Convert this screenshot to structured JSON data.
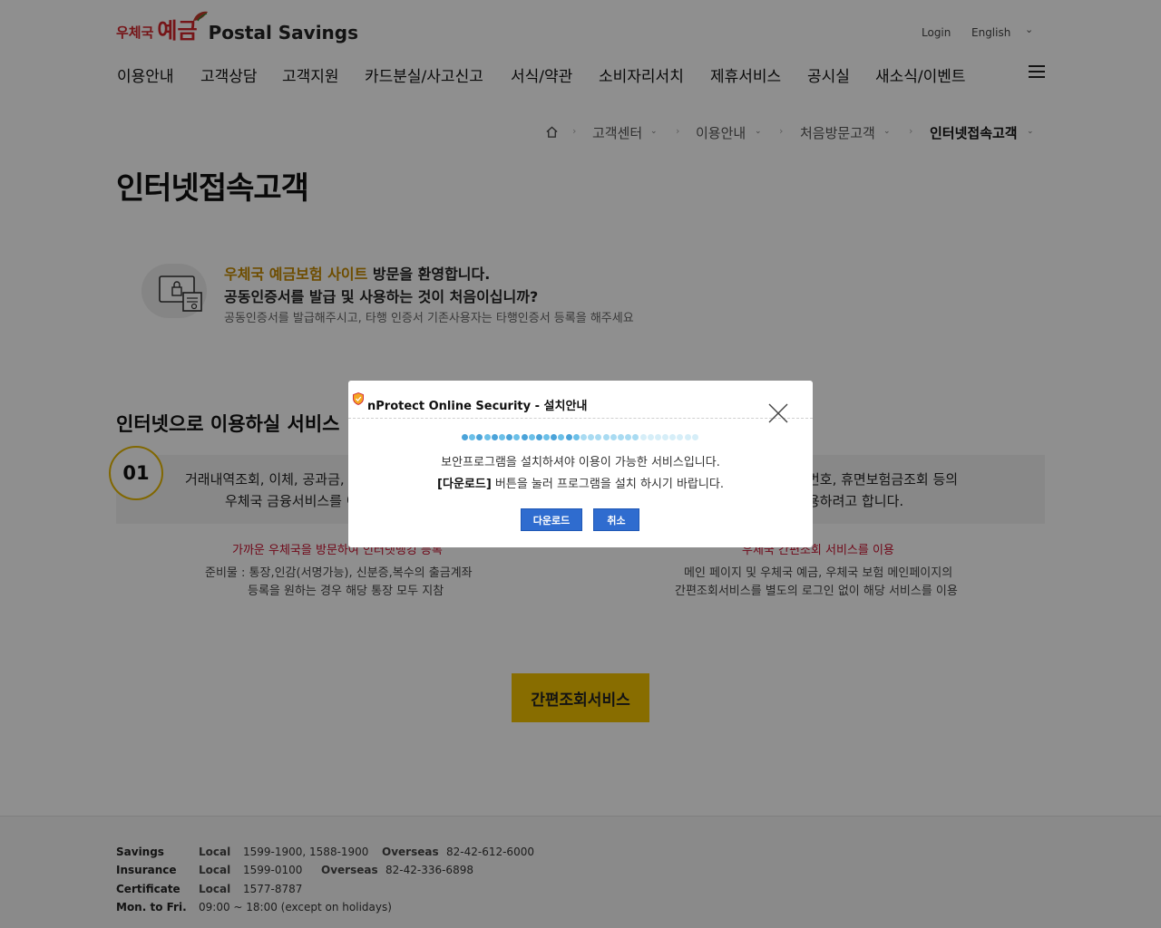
{
  "header": {
    "logo_ko_small": "우체국",
    "logo_ko_big": "예금",
    "logo_en": "Postal Savings",
    "login": "Login",
    "language": "English"
  },
  "gnb": [
    "이용안내",
    "고객상담",
    "고객지원",
    "카드분실/사고신고",
    "서식/약관",
    "소비자리서치",
    "제휴서비스",
    "공시실",
    "새소식/이벤트"
  ],
  "breadcrumb": [
    "고객센터",
    "이용안내",
    "처음방문고객",
    "인터넷접속고객"
  ],
  "page_title": "인터넷접속고객",
  "intro": {
    "highlight": "우체국 예금보험 사이트",
    "line1_rest": " 방문을 환영합니다.",
    "line2": "공동인증서를 발급 및 사용하는 것이 처음이십니까?",
    "line3": "공동인증서를 발급해주시고, 타행 인증서 기존사용자는 타행인증서 등록을 해주세요"
  },
  "section": {
    "title": "인터넷으로 이용하실 서비스",
    "step_number": "01",
    "card1_line1": "거래내역조회, 이체, 공과금,",
    "card1_line2": "우체국 금융서비스를 이",
    "card2_line1": "번호, 휴면보험금조회 등의",
    "card2_line2": "용하려고 합니다.",
    "left_red": "가까운 우체국을 방문하여 인터넷뱅킹 등록",
    "left_gray1": "준비물 : 통장,인감(서명가능), 신분증,복수의 출금계좌",
    "left_gray2": "등록을 원하는 경우 해당 통장 모두 지참",
    "right_red": "우체국 간편조회 서비스를 이용",
    "right_gray1": "메인 페이지 및 우체국 예금, 우체국 보험 메인페이지의",
    "right_gray2": "간편조회서비스를 별도의 로그인 없이 해당 서비스를 이용",
    "button": "간편조회서비스"
  },
  "footer": {
    "savings_label": "Savings",
    "savings_local_label": "Local",
    "savings_local": "1599-1900, 1588-1900",
    "savings_overseas_label": "Overseas",
    "savings_overseas": "82-42-612-6000",
    "insurance_label": "Insurance",
    "insurance_local_label": "Local",
    "insurance_local": "1599-0100",
    "insurance_overseas_label": "Overseas",
    "insurance_overseas": "82-42-336-6898",
    "certificate_label": "Certificate",
    "certificate_local_label": "Local",
    "certificate_local": "1577-8787",
    "hours_label": "Mon. to Fri.",
    "hours": "09:00 ~ 18:00 (except on holidays)"
  },
  "modal": {
    "title": "nProtect Online Security - 설치안내",
    "msg1": "보안프로그램을 설치하셔야 이용이 가능한 서비스입니다.",
    "msg2_bold": "[다운로드]",
    "msg2_rest": " 버튼을 눌러 프로그램을 설치 하시기 바랍니다.",
    "download_button": "다운로드",
    "cancel_button": "취소",
    "progress": 0.5
  },
  "colors": {
    "brand_red": "#d2262b",
    "accent_yellow": "#f2c200",
    "highlight_gold": "#c48a00",
    "modal_button_blue": "#2f6ccf"
  }
}
